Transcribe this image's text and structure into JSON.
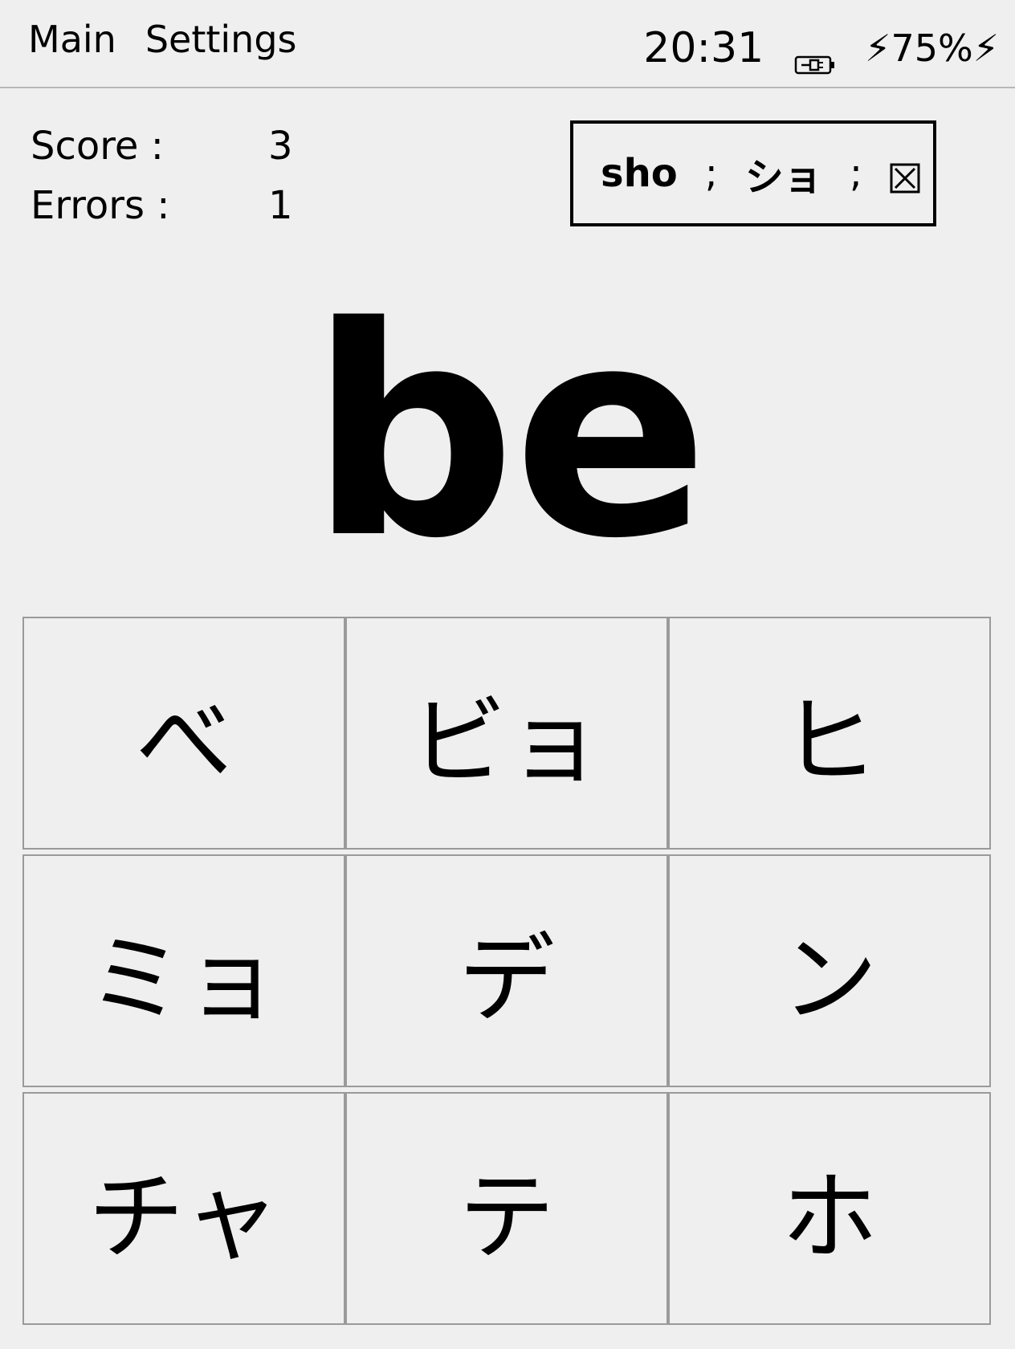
{
  "menu": {
    "main": "Main",
    "settings": "Settings"
  },
  "status": {
    "time": "20:31",
    "battery_text": "⚡75%⚡",
    "battery_percent": 75,
    "battery_icon": "battery-charging-icon"
  },
  "stats": {
    "score_label": "Score :",
    "score_value": "3",
    "errors_label": "Errors :",
    "errors_value": "1"
  },
  "last_answer": {
    "romaji": "sho",
    "sep1": ";",
    "kana": "ショ",
    "sep2": ";",
    "result_icon": "wrong-box-icon"
  },
  "prompt": "be",
  "options": [
    "べ",
    "ビョ",
    "ヒ",
    "ミョ",
    "デ",
    "ン",
    "チャ",
    "テ",
    "ホ"
  ]
}
